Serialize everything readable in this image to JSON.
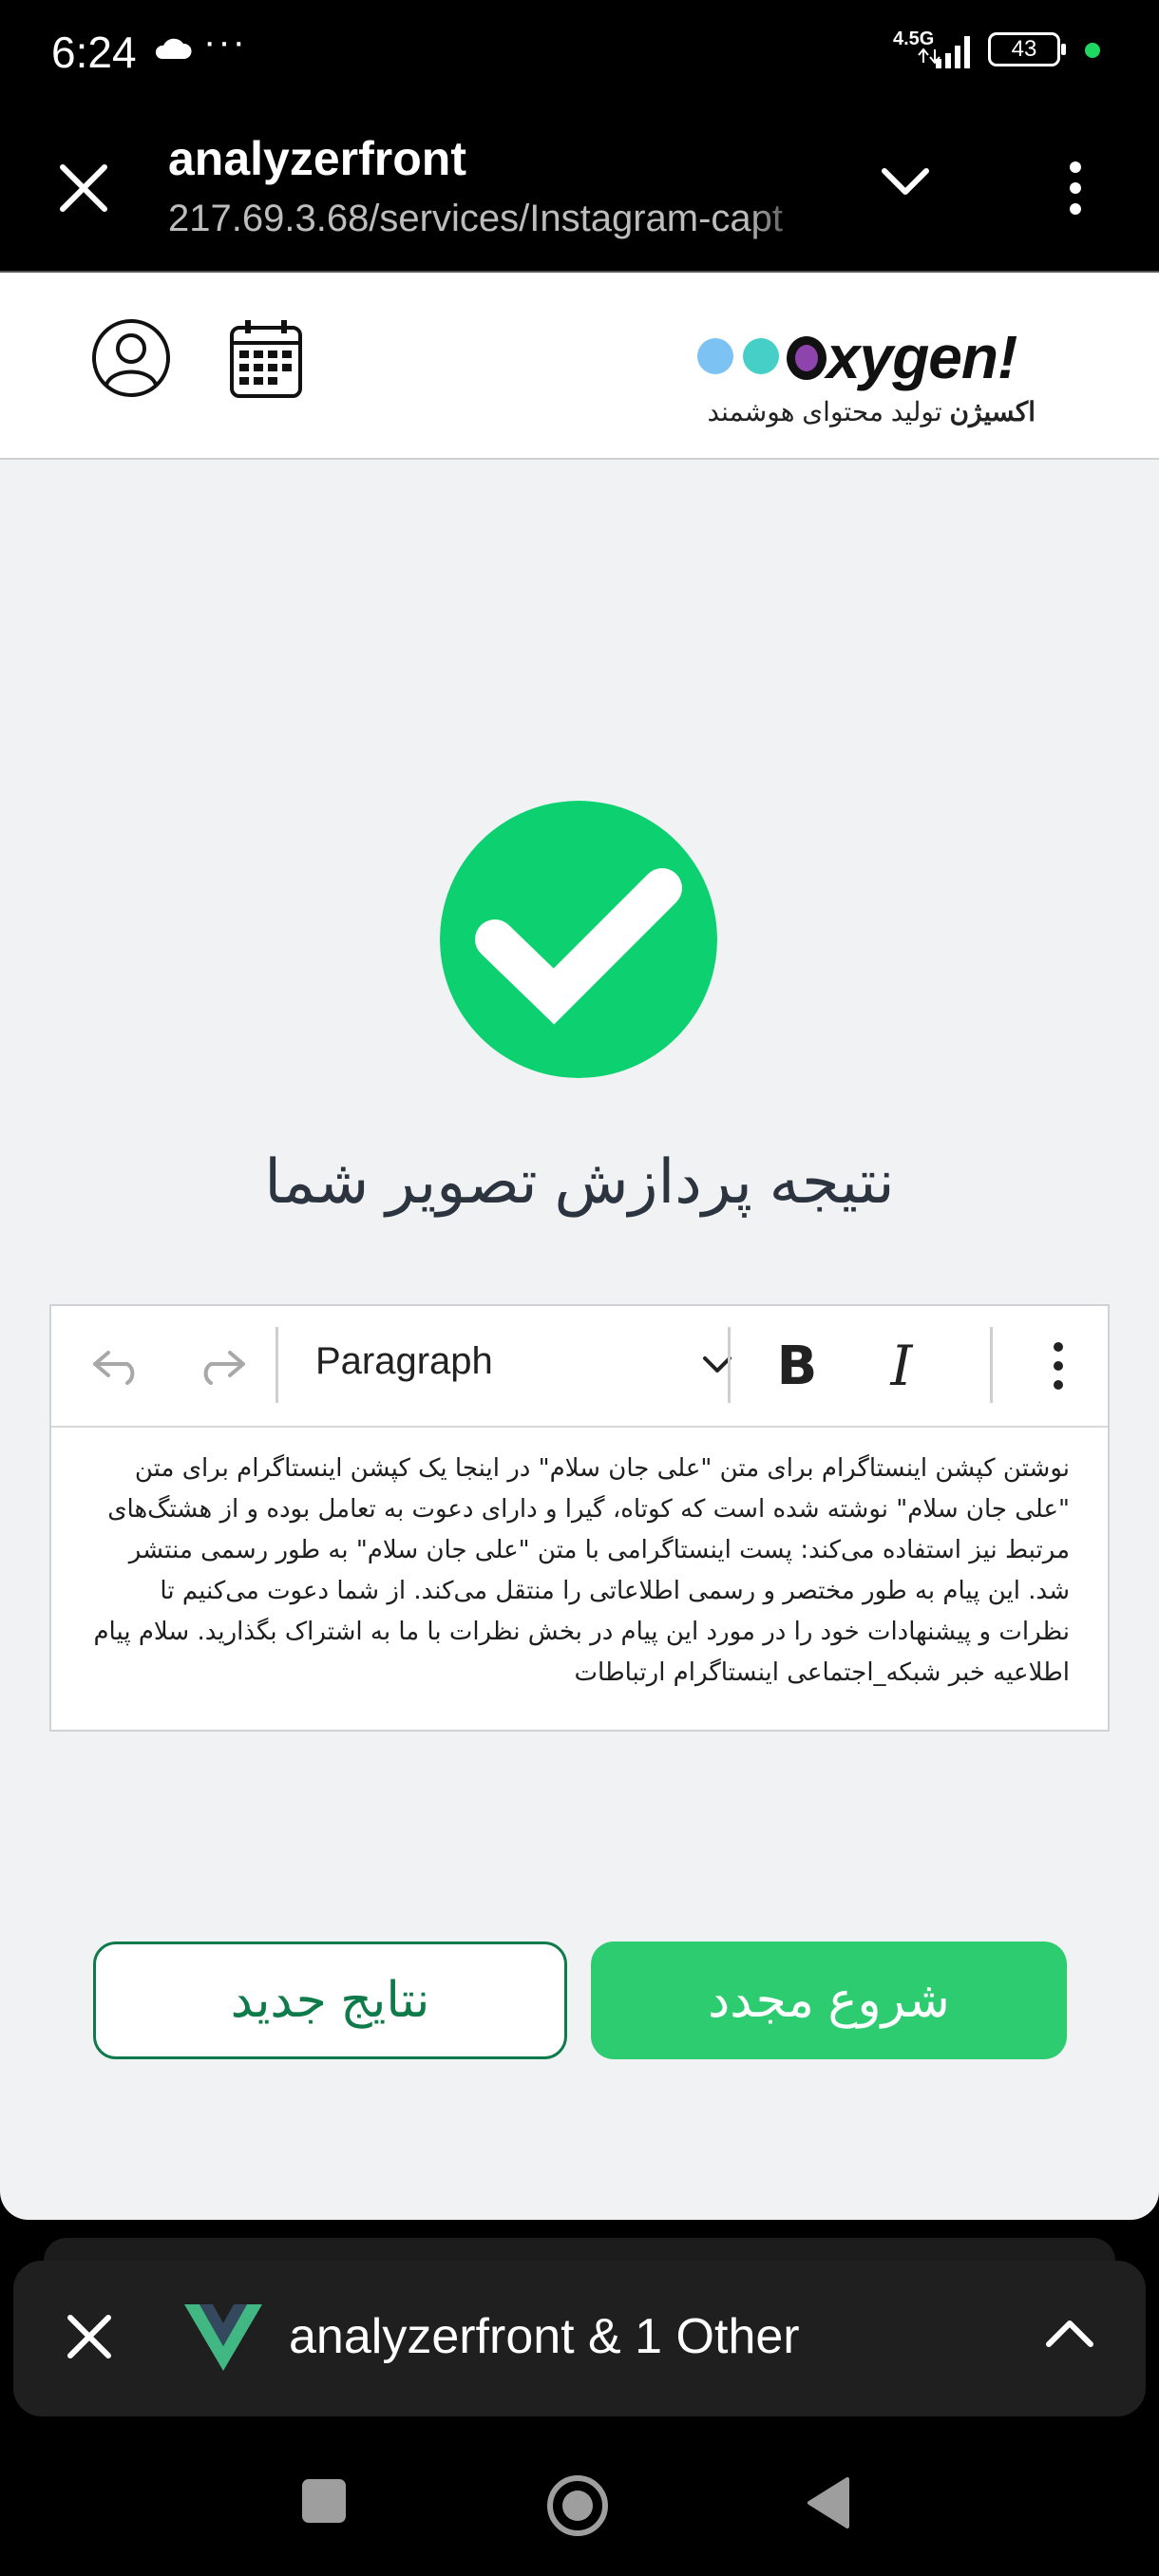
{
  "status_bar": {
    "time": "6:24",
    "network": "4.5G",
    "battery": "43"
  },
  "browser": {
    "title": "analyzerfront",
    "url": "217.69.3.68/services/Instagram-capt"
  },
  "logo": {
    "word": "xygen!",
    "tagline_bold": "اکسیژن",
    "tagline": " تولید محتوای هوشمند"
  },
  "result": {
    "title": "نتیجه پردازش تصویر شما"
  },
  "editor": {
    "block_type": "Paragraph",
    "text": "نوشتن کپشن اینستاگرام برای متن \"علی جان سلام\" در اینجا یک کپشن اینستاگرام برای متن \"علی جان سلام\" نوشته شده است که کوتاه، گیرا و دارای دعوت به تعامل بوده و از هشتگ‌های مرتبط نیز استفاده می‌کند: پست اینستاگرامی با متن \"علی جان سلام\" به طور رسمی منتشر شد. این پیام به طور مختصر و رسمی اطلاعاتی را منتقل می‌کند. از شما دعوت می‌کنیم تا نظرات و پیشنهادات خود را در مورد این پیام در بخش نظرات با ما به اشتراک بگذارید. سلام پیام اطلاعیه خبر شبکه_اجتماعی اینستاگرام ارتباطات"
  },
  "buttons": {
    "new_results": "نتایج جدید",
    "restart": "شروع مجدد"
  },
  "tab_bar": {
    "title": "analyzerfront & 1 Other"
  },
  "colors": {
    "brand_green": "#2ecc71",
    "check_green": "#0dd170",
    "outline_green": "#0f7a4a"
  }
}
